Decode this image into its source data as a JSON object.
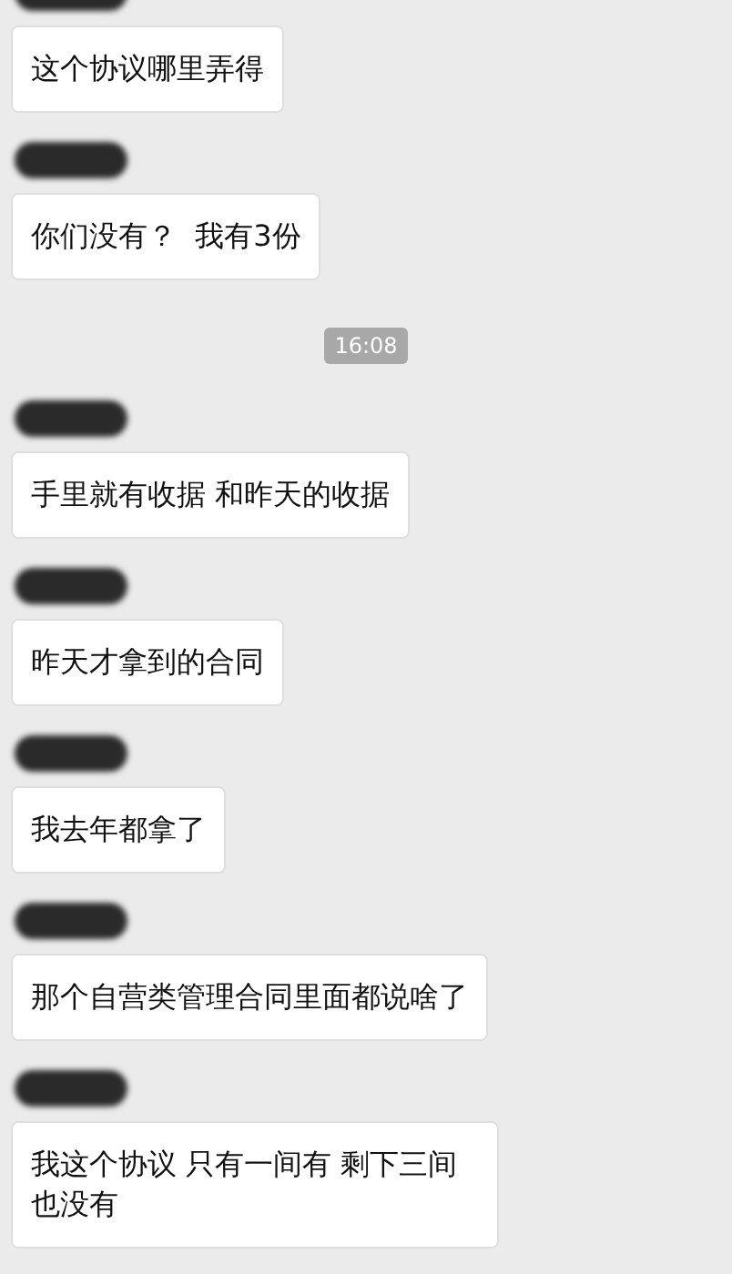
{
  "messages": [
    {
      "kind": "message",
      "text": "这个协议哪里弄得"
    },
    {
      "kind": "message",
      "text": "你们没有？  我有3份"
    },
    {
      "kind": "time",
      "text": "16:08"
    },
    {
      "kind": "message",
      "text": "手里就有收据 和昨天的收据"
    },
    {
      "kind": "message",
      "text": "昨天才拿到的合同"
    },
    {
      "kind": "message",
      "text": "我去年都拿了"
    },
    {
      "kind": "message",
      "text": "那个自营类管理合同里面都说啥了"
    },
    {
      "kind": "message",
      "text": "我这个协议 只有一间有 剩下三间也没有"
    }
  ]
}
